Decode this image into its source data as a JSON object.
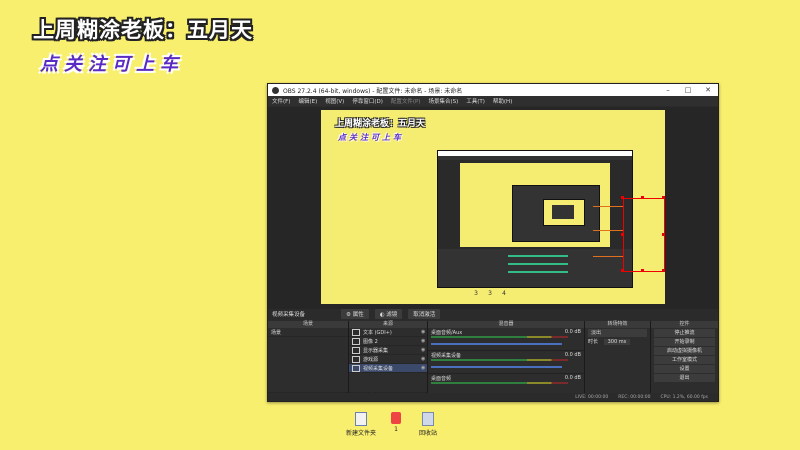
{
  "overlay": {
    "title": "上周糊涂老板：五月天",
    "subtitle": "点关注可上车"
  },
  "obs": {
    "window_title": "OBS 27.2.4 (64-bit, windows) - 配置文件: 未命名 - 场景: 未命名",
    "menu": [
      "文件(F)",
      "编辑(E)",
      "视图(V)",
      "停靠窗口(D)",
      "配置文件(P)",
      "场景集合(S)",
      "工具(T)",
      "帮助(H)"
    ],
    "canvas_title": "上周糊涂老板：五月天",
    "canvas_subtitle": "点关注可上车",
    "canvas_icons": [
      "3",
      "3",
      "4"
    ],
    "source_toolbar": {
      "selected_source": "视频采集设备",
      "properties": "属性",
      "filters": "滤镜",
      "deactivate": "取消激活"
    },
    "scenes_dock": {
      "header": "场景",
      "items": [
        "场景"
      ]
    },
    "sources_dock": {
      "header": "来源",
      "items": [
        "文本 (GDI+)",
        "图像 2",
        "显示器采集",
        "游戏源",
        "视频采集设备"
      ]
    },
    "mixer_dock": {
      "header": "混音器",
      "rows": [
        {
          "label": "桌面音频/Aux",
          "db": "0.0 dB"
        },
        {
          "label": "视频采集设备",
          "db": "0.0 dB"
        },
        {
          "label": "桌面音频",
          "db": "0.0 dB"
        }
      ]
    },
    "transitions_dock": {
      "header": "转场特效",
      "type": "淡出",
      "duration_label": "时长",
      "duration_value": "300 ms"
    },
    "controls_dock": {
      "header": "控件",
      "buttons": [
        "停止推流",
        "开始录制",
        "启动虚拟摄像机",
        "工作室模式",
        "设置",
        "退出"
      ]
    },
    "status": {
      "live": "LIVE: 00:00:00",
      "rec": "REC: 00:00:00",
      "cpu": "CPU: 1.2%, 60.00 fps"
    }
  },
  "desktop_icons": [
    {
      "label": "新建文件夹"
    },
    {
      "label": "1"
    },
    {
      "label": "回收站"
    }
  ]
}
